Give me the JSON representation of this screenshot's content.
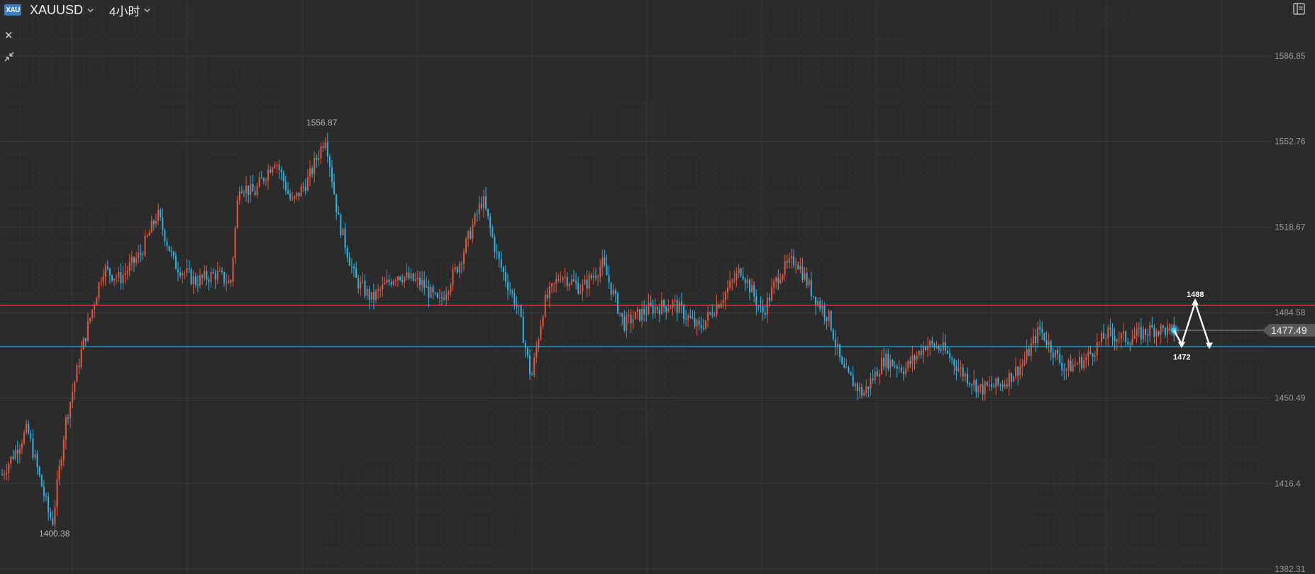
{
  "header": {
    "symbol_badge": "XAU",
    "symbol": "XAUUSD",
    "timeframe": "4小时"
  },
  "colors": {
    "background": "#2b2b2b",
    "grid": "#4a4a4a",
    "up_candle": "#e8573c",
    "down_candle": "#2bb3e6",
    "resistance_line": "#e8573c",
    "support_line": "#2bb3e6",
    "axis_text": "#9a9a9a",
    "price_tag": "#5a5a5a"
  },
  "icons": {
    "close": "close-icon",
    "collapse": "collapse-icon",
    "symbol_dropdown": "chevron-down-icon",
    "timeframe_dropdown": "chevron-down-icon",
    "sidebar_toggle": "sidebar-toggle-icon"
  },
  "chart_data": {
    "type": "candlestick",
    "symbol": "XAUUSD",
    "interval": "4小时",
    "y_axis_labels": [
      "1586.85",
      "1552.76",
      "1518.67",
      "1484.58",
      "1450.49",
      "1416.4",
      "1382.31"
    ],
    "ylim": [
      1382.31,
      1586.85
    ],
    "grid": true,
    "current_price": "1477.49",
    "current_price_value": 1477.49,
    "annotations": {
      "high_label": "1556.87",
      "high_value": 1556.87,
      "low_label": "1400.38",
      "low_value": 1400.38,
      "forecast_high_label": "1488",
      "forecast_high_value": 1488,
      "forecast_low_label": "1472",
      "forecast_low_value": 1472
    },
    "horizontal_lines": [
      {
        "name": "resistance",
        "value": 1487.5
      },
      {
        "name": "support",
        "value": 1471
      }
    ],
    "price_path": [
      [
        0,
        1420
      ],
      [
        30,
        1438
      ],
      [
        55,
        1405
      ],
      [
        60,
        1401
      ],
      [
        75,
        1440
      ],
      [
        95,
        1470
      ],
      [
        120,
        1502
      ],
      [
        140,
        1498
      ],
      [
        165,
        1508
      ],
      [
        185,
        1524
      ],
      [
        205,
        1504
      ],
      [
        230,
        1497
      ],
      [
        255,
        1500
      ],
      [
        272,
        1496
      ],
      [
        282,
        1536
      ],
      [
        300,
        1532
      ],
      [
        325,
        1546
      ],
      [
        345,
        1528
      ],
      [
        365,
        1538
      ],
      [
        385,
        1555
      ],
      [
        400,
        1522
      ],
      [
        420,
        1498
      ],
      [
        440,
        1490
      ],
      [
        470,
        1500
      ],
      [
        500,
        1496
      ],
      [
        520,
        1488
      ],
      [
        545,
        1505
      ],
      [
        572,
        1530
      ],
      [
        590,
        1506
      ],
      [
        615,
        1485
      ],
      [
        630,
        1458
      ],
      [
        645,
        1488
      ],
      [
        665,
        1500
      ],
      [
        690,
        1494
      ],
      [
        715,
        1504
      ],
      [
        740,
        1480
      ],
      [
        770,
        1486
      ],
      [
        800,
        1488
      ],
      [
        830,
        1478
      ],
      [
        860,
        1492
      ],
      [
        880,
        1502
      ],
      [
        905,
        1484
      ],
      [
        925,
        1500
      ],
      [
        945,
        1506
      ],
      [
        965,
        1492
      ],
      [
        985,
        1482
      ],
      [
        1000,
        1462
      ],
      [
        1025,
        1452
      ],
      [
        1050,
        1466
      ],
      [
        1075,
        1462
      ],
      [
        1100,
        1472
      ],
      [
        1120,
        1470
      ],
      [
        1145,
        1460
      ],
      [
        1165,
        1454
      ],
      [
        1190,
        1456
      ],
      [
        1215,
        1464
      ],
      [
        1235,
        1478
      ],
      [
        1265,
        1462
      ],
      [
        1290,
        1466
      ],
      [
        1315,
        1476
      ],
      [
        1340,
        1474
      ],
      [
        1370,
        1478
      ],
      [
        1400,
        1477
      ]
    ]
  }
}
